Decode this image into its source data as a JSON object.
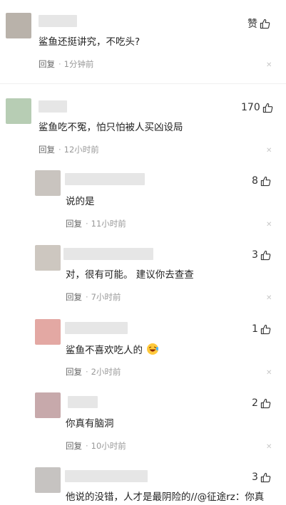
{
  "colors": {
    "avatar_1": "#b9b2aa",
    "avatar_2": "#b7cdb4",
    "avatar_3": "#c9c4bf",
    "avatar_4": "#cdc7c0",
    "avatar_5": "#e3a8a3",
    "avatar_6": "#c7a9ab",
    "avatar_7": "#c6c3c1",
    "name_blur": "#e6e6e6"
  },
  "comments": [
    {
      "text": "鲨鱼还挺讲究，不吃头?",
      "like_label": "赞",
      "reply": "回复",
      "dot": "·",
      "time": "1分钟前",
      "close": "✕"
    },
    {
      "text": "鲨鱼吃不冤，怕只怕被人买凶设局",
      "like_count": "170",
      "reply": "回复",
      "dot": "·",
      "time": "12小时前",
      "close": "✕"
    }
  ],
  "replies": [
    {
      "text": "说的是",
      "like_count": "8",
      "reply": "回复",
      "dot": "·",
      "time": "11小时前",
      "close": "✕"
    },
    {
      "text": "对，很有可能。 建议你去查查",
      "like_count": "3",
      "reply": "回复",
      "dot": "·",
      "time": "7小时前",
      "close": "✕"
    },
    {
      "text": "鲨鱼不喜欢吃人的",
      "like_count": "1",
      "reply": "回复",
      "dot": "·",
      "time": "2小时前",
      "close": "✕"
    },
    {
      "text": "你真有脑洞",
      "like_count": "2",
      "reply": "回复",
      "dot": "·",
      "time": "10小时前",
      "close": "✕"
    },
    {
      "text": "他说的没错，人才是最阴险的//@征途rz：你真",
      "like_count": "3"
    }
  ]
}
